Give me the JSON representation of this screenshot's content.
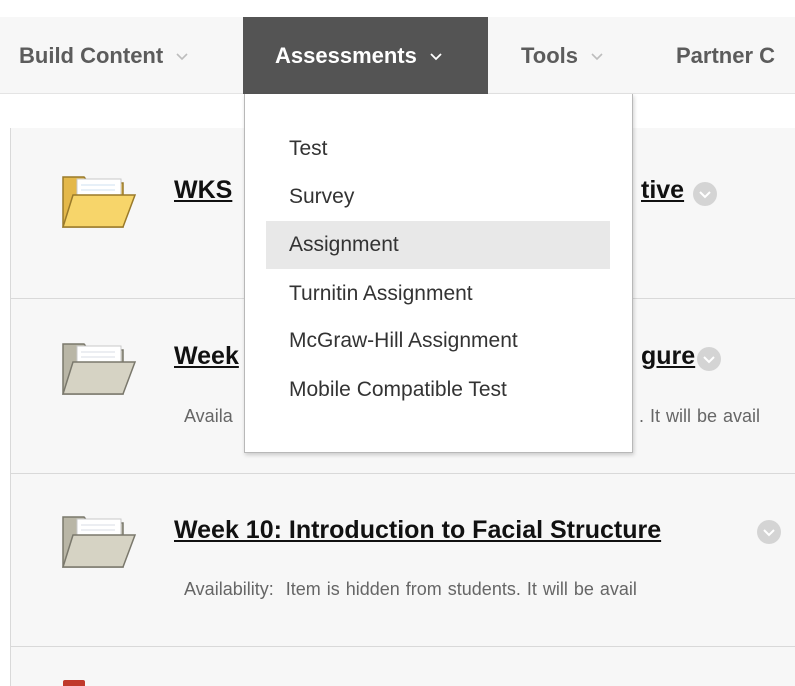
{
  "action_bar": {
    "items": [
      {
        "label": "Build Content"
      },
      {
        "label": "Assessments",
        "active": true
      },
      {
        "label": "Tools"
      },
      {
        "label": "Partner C"
      }
    ]
  },
  "assessments_menu": {
    "items": [
      {
        "label": "Test"
      },
      {
        "label": "Survey"
      },
      {
        "label": "Assignment",
        "highlighted": true
      },
      {
        "label": "Turnitin Assignment"
      },
      {
        "label": "McGraw-Hill Assignment"
      },
      {
        "label": "Mobile Compatible Test"
      }
    ]
  },
  "content_items": [
    {
      "title_start": "WKS",
      "title_end": "tive",
      "icon": "folder-open-yellow-icon",
      "availability_label": "",
      "availability_text": ""
    },
    {
      "title_start": "Week",
      "title_end": "gure",
      "icon": "folder-open-gray-icon",
      "availability_label": "Availa",
      "availability_text": ". It will be avail"
    },
    {
      "title": "Week 10: Introduction to Facial Structure",
      "icon": "folder-open-gray-icon",
      "availability_label": "Availability:",
      "availability_text": "Item is hidden from students. It will be avail"
    }
  ],
  "colors": {
    "active_tab_bg": "#545454",
    "bar_bg": "#f7f7f7",
    "menu_hover_bg": "#e8e8e8",
    "folder_yellow": "#f5cf5e",
    "folder_gray": "#d6d3c4"
  }
}
